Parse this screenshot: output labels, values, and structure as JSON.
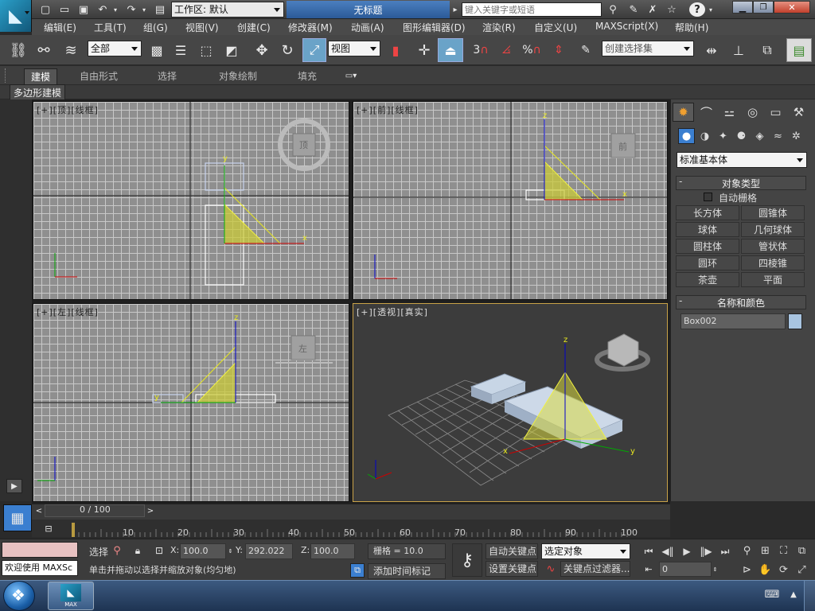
{
  "titlebar": {
    "workspace_label": "工作区: 默认",
    "doc_title": "无标题",
    "search_placeholder": "键入关键字或短语"
  },
  "menu": [
    "编辑(E)",
    "工具(T)",
    "组(G)",
    "视图(V)",
    "创建(C)",
    "修改器(M)",
    "动画(A)",
    "图形编辑器(D)",
    "渲染(R)",
    "自定义(U)",
    "MAXScript(X)",
    "帮助(H)"
  ],
  "toolbar": {
    "filter_value": "全部",
    "ref_coord_value": "视图",
    "named_sel_placeholder": "创建选择集",
    "snap_label": "3",
    "percent_label": "%"
  },
  "ribbon": {
    "tabs": [
      "建模",
      "自由形式",
      "选择",
      "对象绘制",
      "填充"
    ],
    "active_tab": "建模",
    "subpanel": "多边形建模"
  },
  "viewports": [
    {
      "label": "[+][顶][线框]"
    },
    {
      "label": "[+][前][线框]"
    },
    {
      "label": "[+][左][线框]"
    },
    {
      "label": "[+][透视][真实]"
    }
  ],
  "viewcube": {
    "top": "顶",
    "front": "前",
    "left": "左"
  },
  "axis": {
    "x": "x",
    "y": "y",
    "z": "z"
  },
  "command_panel": {
    "category_value": "标准基本体",
    "object_type_header": "对象类型",
    "autogrid_label": "自动栅格",
    "buttons": [
      "长方体",
      "圆锥体",
      "球体",
      "几何球体",
      "圆柱体",
      "管状体",
      "圆环",
      "四棱锥",
      "茶壶",
      "平面"
    ],
    "name_color_header": "名称和颜色",
    "object_name": "Box002",
    "object_color": "#a8c4e0"
  },
  "timeline": {
    "slider_text": "0 / 100",
    "ticks": [
      "10",
      "20",
      "30",
      "40",
      "50",
      "60",
      "70",
      "80",
      "90",
      "100"
    ]
  },
  "status": {
    "welcome": "欢迎使用 MAXSc",
    "select_label": "选择",
    "x_label": "X:",
    "x_value": "100.0",
    "y_label": "Y:",
    "y_value": "292.022",
    "z_label": "Z:",
    "z_value": "100.0",
    "grid": "栅格 = 10.0",
    "prompt": "单击并拖动以选择并缩放对象(均匀地)",
    "add_time_tag": "添加时间标记",
    "auto_key": "自动关键点",
    "set_key": "设置关键点",
    "key_mode_value": "选定对象",
    "key_filters": "关键点过滤器...",
    "frame_value": "0"
  },
  "taskbar": {
    "app_label": "MAX"
  },
  "colors": {
    "accent": "#3b7fd0",
    "selection_yellow": "#e8e020",
    "box_blue": "#a8c4e0"
  }
}
